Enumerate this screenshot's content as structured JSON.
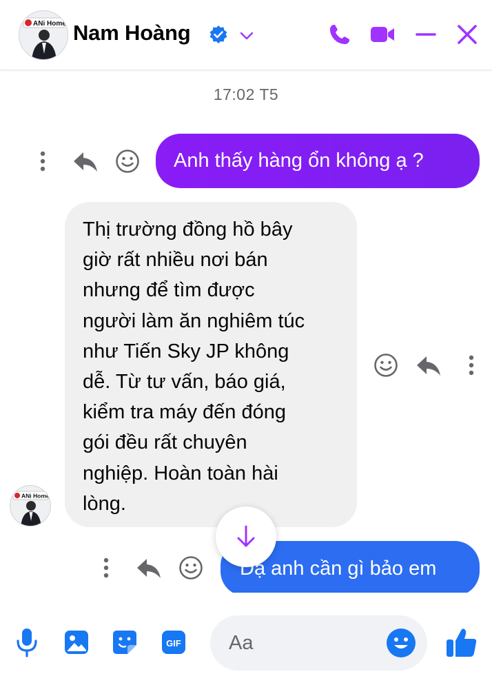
{
  "header": {
    "contact_name": "Nam Hoàng",
    "avatar_logo_text": "ANi Home",
    "icons": [
      "verified-badge-icon",
      "chevron-down-icon",
      "phone-icon",
      "video-icon",
      "minimize-icon",
      "close-icon"
    ]
  },
  "timestamp": "17:02 T5",
  "messages": [
    {
      "direction": "outgoing",
      "color": "#8a1cf6",
      "text": "Anh thấy hàng ổn không ạ ?"
    },
    {
      "direction": "incoming",
      "text_lines": [
        "Thị trường đồng hồ bây",
        "giờ rất nhiều nơi bán",
        "nhưng để tìm được",
        "người làm ăn nghiêm túc",
        "như Tiến Sky JP không",
        "dễ. Từ tư vấn, báo giá,",
        "kiểm tra máy đến đóng",
        "gói đều rất chuyên",
        "nghiệp. Hoàn toàn hài",
        "lòng."
      ]
    },
    {
      "direction": "outgoing",
      "color": "#2c6df1",
      "text": "Dạ anh cần gì bảo em"
    }
  ],
  "composer": {
    "placeholder": "Aa",
    "gif_label": "GIF",
    "icons": [
      "microphone-icon",
      "image-icon",
      "sticker-icon",
      "gif-icon",
      "emoji-icon",
      "thumbs-up-icon"
    ]
  },
  "colors": {
    "accent": "#a033ff",
    "outgoing_purple": "#8a1cf6",
    "outgoing_blue": "#2c6df1",
    "composer_blue": "#1877f2",
    "incoming_bg": "#f0f0f0"
  }
}
